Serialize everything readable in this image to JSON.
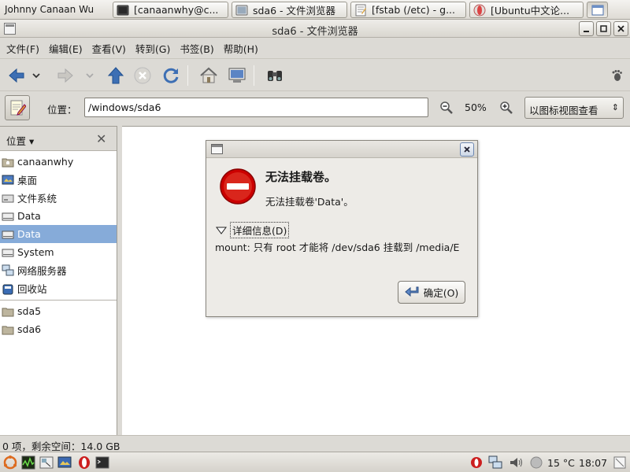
{
  "top_panel": {
    "user_name": "Johnny Canaan Wu",
    "tasks": [
      {
        "label": "[canaanwhy@c...",
        "icon": "terminal-icon"
      },
      {
        "label": "sda6 - 文件浏览器",
        "icon": "file-browser-icon"
      },
      {
        "label": "[fstab (/etc) - g...",
        "icon": "text-editor-icon"
      },
      {
        "label": "[Ubuntu中文论...",
        "icon": "web-browser-icon"
      }
    ]
  },
  "window": {
    "title": "sda6 - 文件浏览器"
  },
  "menubar": {
    "items": [
      "文件(F)",
      "编辑(E)",
      "查看(V)",
      "转到(G)",
      "书签(B)",
      "帮助(H)"
    ]
  },
  "location": {
    "label": "位置：",
    "path": "/windows/sda6",
    "zoom": "50%",
    "view_mode": "以图标视图查看"
  },
  "sidepane": {
    "selector": "位置",
    "items": [
      {
        "label": "canaanwhy",
        "icon": "home-folder-icon"
      },
      {
        "label": "桌面",
        "icon": "desktop-icon"
      },
      {
        "label": "文件系统",
        "icon": "filesystem-icon"
      },
      {
        "label": "Data",
        "icon": "drive-icon"
      },
      {
        "label": "Data",
        "icon": "drive-icon",
        "selected": true
      },
      {
        "label": "System",
        "icon": "drive-icon"
      },
      {
        "label": "网络服务器",
        "icon": "network-icon"
      },
      {
        "label": "回收站",
        "icon": "trash-icon"
      }
    ],
    "bookmarks": [
      {
        "label": "sda5",
        "icon": "folder-icon"
      },
      {
        "label": "sda6",
        "icon": "folder-icon"
      }
    ]
  },
  "status": {
    "text": "0 项，剩余空间：14.0 GB"
  },
  "bottom_panel": {
    "temperature": "15 °C",
    "clock": "18:07"
  },
  "dialog": {
    "primary": "无法挂载卷。",
    "secondary": "无法挂载卷'Data'。",
    "details_label": "详细信息(D)",
    "details_text": "mount: 只有  root 才能将  /dev/sda6 挂载到  /media/E",
    "ok_label": "确定(O)"
  },
  "colors": {
    "selection": "#86abd9",
    "error_red": "#cc0000",
    "panel": "#dcdad5"
  }
}
